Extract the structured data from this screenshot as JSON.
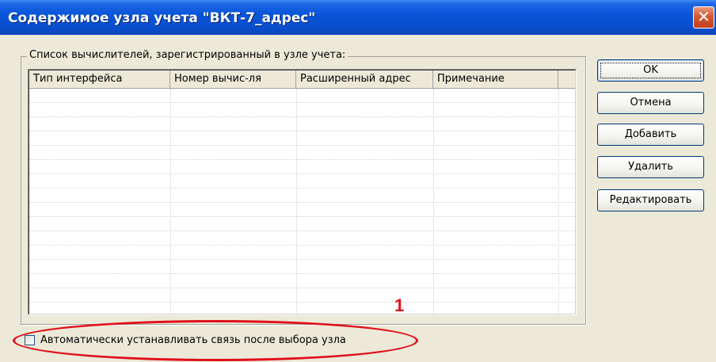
{
  "window": {
    "title": "Содержимое узла учета \"ВКТ-7_адрес\"",
    "close_label": "✕"
  },
  "groupbox": {
    "label": "Список вычислителей, зарегистрированный в узле учета:"
  },
  "table": {
    "columns": [
      "Тип интерфейса",
      "Номер вычис-ля",
      "Расширенный адрес",
      "Примечание"
    ],
    "rows": []
  },
  "buttons": {
    "ok": "OK",
    "cancel": "Отмена",
    "add": "Добавить",
    "delete": "Удалить",
    "edit": "Редактировать"
  },
  "auto_connect": {
    "label": "Автоматически устанавливать связь после выбора узла",
    "checked": false
  },
  "annotation": {
    "number": "1",
    "color": "#e0101a"
  }
}
